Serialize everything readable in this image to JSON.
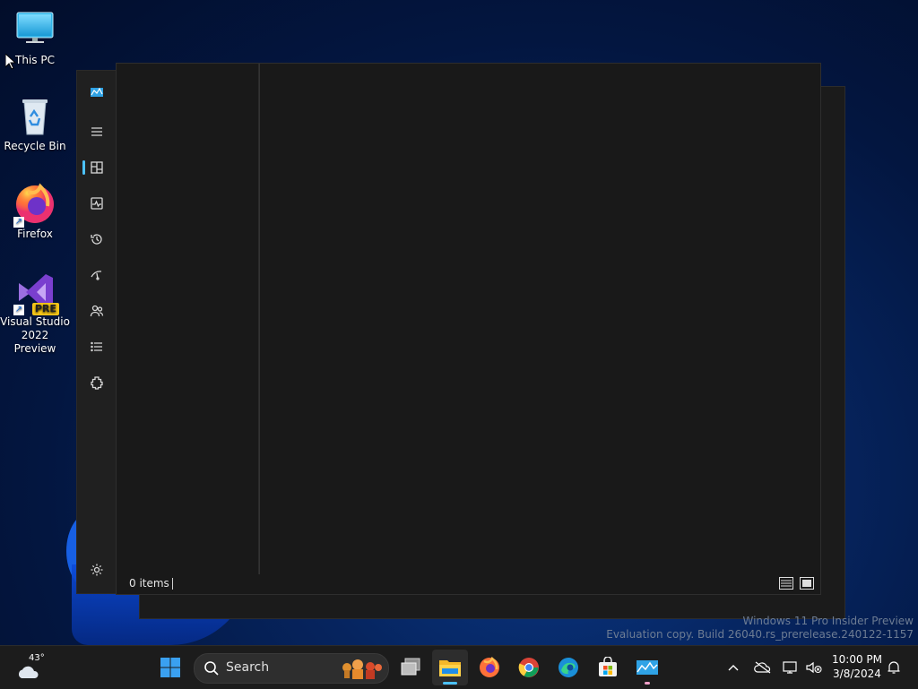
{
  "desktop": {
    "icons": [
      {
        "label": "This PC"
      },
      {
        "label": "Recycle Bin"
      },
      {
        "label": "Firefox"
      },
      {
        "label": "Visual Studio 2022 Preview",
        "badge": "PRE"
      }
    ]
  },
  "app": {
    "rail": {
      "items": [
        "app-logo-icon",
        "menu-icon",
        "processes-icon",
        "performance-icon",
        "app-history-icon",
        "startup-apps-icon",
        "users-icon",
        "details-icon",
        "services-icon"
      ],
      "settings": "settings-icon"
    },
    "status": {
      "items_text": "0 items"
    }
  },
  "watermark": {
    "line1": "Windows 11 Pro Insider Preview",
    "line2": "Evaluation copy. Build 26040.rs_prerelease.240122-1157"
  },
  "taskbar": {
    "weather": {
      "temp": "43°"
    },
    "search_placeholder": "Search",
    "apps": [
      "start-icon",
      "task-view-icon",
      "file-explorer-icon",
      "firefox-icon",
      "chrome-icon",
      "edge-icon",
      "microsoft-store-icon",
      "task-manager-icon"
    ],
    "clock": {
      "time": "10:00 PM",
      "date": "3/8/2024"
    }
  },
  "colors": {
    "accent": "#4cc2ff",
    "window_bg": "#191919",
    "taskbar_bg": "#1c1c1c"
  }
}
